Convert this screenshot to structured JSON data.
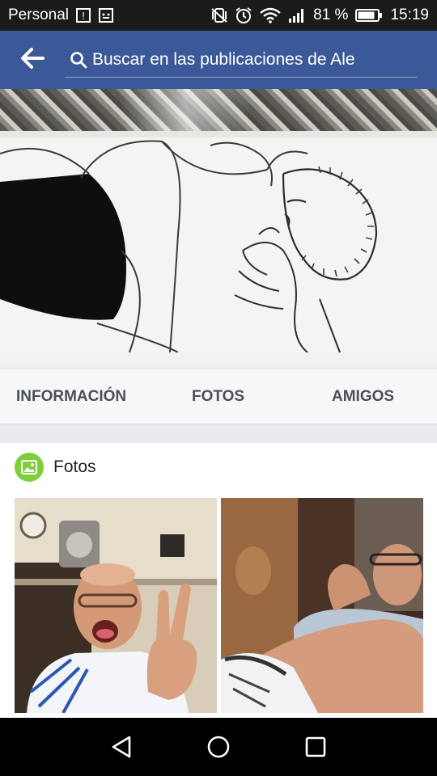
{
  "status_bar": {
    "carrier": "Personal",
    "battery_percent": "81 %",
    "time": "15:19",
    "icons": [
      "sim-card-icon",
      "notification-icon",
      "vibrate-icon",
      "alarm-icon",
      "wifi-icon",
      "signal-icon",
      "battery-icon"
    ]
  },
  "header": {
    "back_icon": "arrow-left-icon",
    "search_icon": "search-icon",
    "search_text": "Buscar en las publicaciones de Ale",
    "color": "#3b5998"
  },
  "tabs": [
    {
      "label": "INFORMACIÓN"
    },
    {
      "label": "FOTOS"
    },
    {
      "label": "AMIGOS"
    }
  ],
  "photos_section": {
    "icon": "photo-icon",
    "badge_color": "#7fcf3c",
    "title": "Fotos"
  },
  "nav_bar": {
    "icons": [
      "back-triangle-icon",
      "home-circle-icon",
      "recents-square-icon"
    ]
  }
}
